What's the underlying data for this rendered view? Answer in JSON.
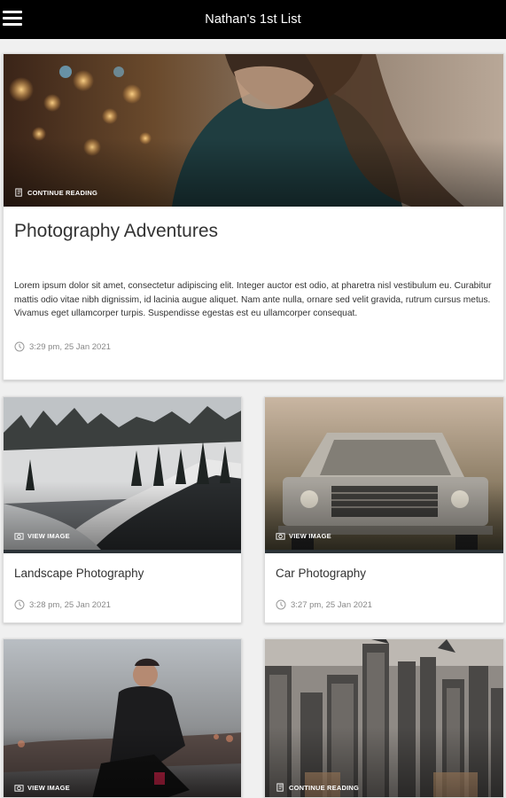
{
  "header": {
    "title": "Nathan's 1st List",
    "menu_icon": "hamburger-menu-icon"
  },
  "featured": {
    "badge": "CONTINUE READING",
    "badge_icon": "document-icon",
    "title": "Photography Adventures",
    "body": "Lorem ipsum dolor sit amet, consectetur adipiscing elit. Integer auctor est odio, at pharetra nisl vestibulum eu. Curabitur mattis odio vitae nibh dignissim, id lacinia augue aliquet. Nam ante nulla, ornare sed velit gravida, rutrum cursus metus. Vivamus eget ullamcorper turpis. Suspendisse egestas est eu ullamcorper consequat.",
    "timestamp": "3:29 pm, 25 Jan 2021",
    "timestamp_icon": "clock-icon"
  },
  "cards": [
    {
      "badge": "VIEW IMAGE",
      "badge_icon": "camera-icon",
      "title": "Landscape Photography",
      "timestamp": "3:28 pm, 25 Jan 2021"
    },
    {
      "badge": "VIEW IMAGE",
      "badge_icon": "camera-icon",
      "title": "Car Photography",
      "timestamp": "3:27 pm, 25 Jan 2021"
    },
    {
      "badge": "VIEW IMAGE",
      "badge_icon": "camera-icon"
    },
    {
      "badge": "CONTINUE READING",
      "badge_icon": "document-icon"
    }
  ],
  "colors": {
    "header_bg": "#000000",
    "header_text": "#ffffff",
    "title_text": "#333333",
    "timestamp_text": "#888888"
  }
}
